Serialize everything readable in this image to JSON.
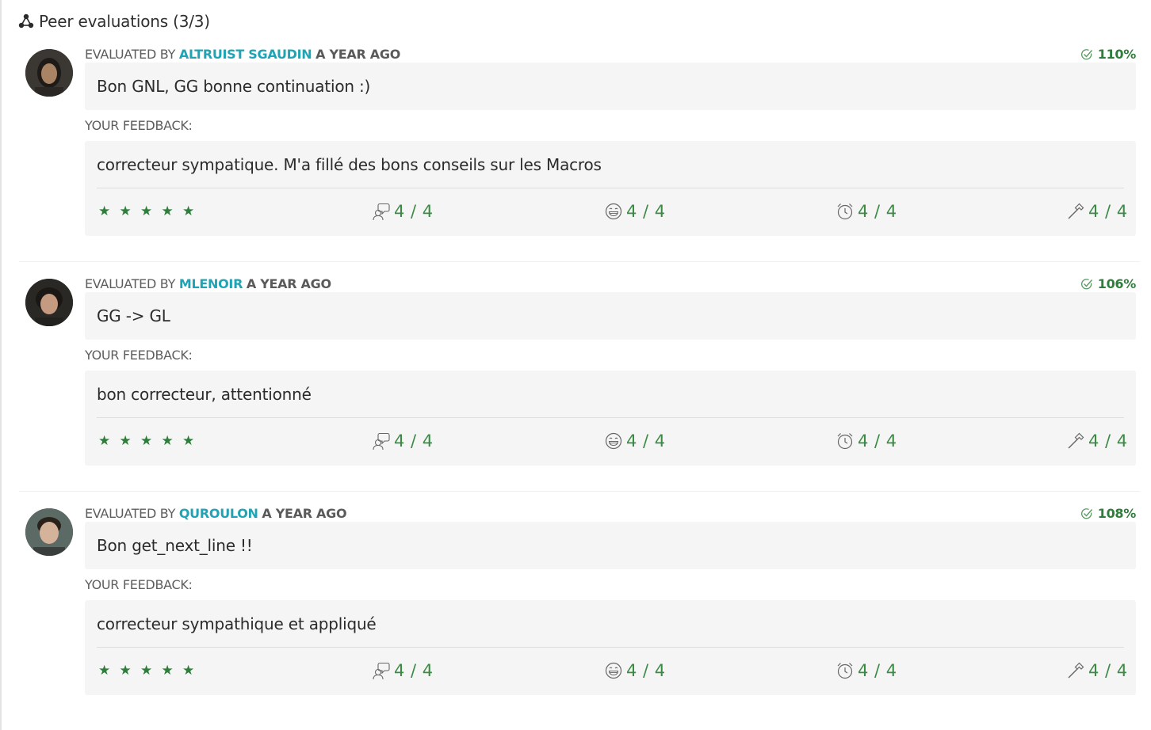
{
  "header": {
    "title": "Peer evaluations (3/3)",
    "icon": "network-nodes-icon"
  },
  "labels": {
    "evaluated_by": "Evaluated by",
    "your_feedback": "YOUR FEEDBACK:"
  },
  "colors": {
    "accent_name": "#1fa4b6",
    "success": "#2f7d3a",
    "box_bg": "#f5f5f5"
  },
  "criteria_icons": [
    "talk-icon",
    "smile-icon",
    "alarm-clock-icon",
    "hammer-icon"
  ],
  "evaluations": [
    {
      "evaluator": "altruist sgaudin",
      "time_ago": "a year ago",
      "score": "110%",
      "comment": "Bon GNL, GG bonne continuation :)",
      "feedback": "correcteur sympatique. M'a fillé des bons conseils sur les Macros",
      "stars": "★★★★★",
      "criteria": [
        "4 / 4",
        "4 / 4",
        "4 / 4",
        "4 / 4"
      ]
    },
    {
      "evaluator": "mlenoir",
      "time_ago": "a year ago",
      "score": "106%",
      "comment": "GG -> GL",
      "feedback": "bon correcteur, attentionné",
      "stars": "★★★★★",
      "criteria": [
        "4 / 4",
        "4 / 4",
        "4 / 4",
        "4 / 4"
      ]
    },
    {
      "evaluator": "quroulon",
      "time_ago": "a year ago",
      "score": "108%",
      "comment": "Bon get_next_line !!",
      "feedback": "correcteur sympathique et appliqué",
      "stars": "★★★★★",
      "criteria": [
        "4 / 4",
        "4 / 4",
        "4 / 4",
        "4 / 4"
      ]
    }
  ]
}
